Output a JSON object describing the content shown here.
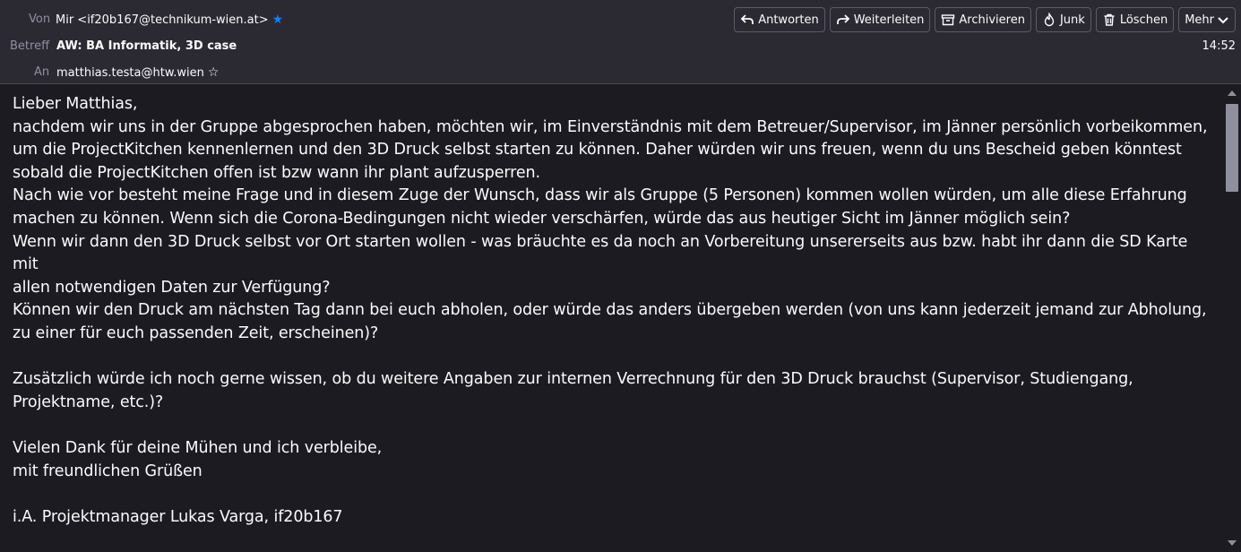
{
  "header": {
    "from_label": "Von",
    "from_value": "Mir <if20b167@technikum-wien.at>",
    "subject_label": "Betreff",
    "subject_value": "AW: BA Informatik, 3D case",
    "to_label": "An",
    "to_value": "matthias.testa@htw.wien",
    "time": "14:52"
  },
  "toolbar": {
    "reply": "Antworten",
    "forward": "Weiterleiten",
    "archive": "Archivieren",
    "junk": "Junk",
    "delete": "Löschen",
    "more": "Mehr"
  },
  "message": {
    "body": "Lieber Matthias,\nnachdem wir uns in der Gruppe abgesprochen haben, möchten wir, im Einverständnis mit dem Betreuer/Supervisor, im Jänner persönlich vorbeikommen,\num die ProjectKitchen kennenlernen und den 3D Druck selbst starten zu können. Daher würden wir uns freuen, wenn du uns Bescheid geben könntest\nsobald die ProjectKitchen offen ist bzw wann ihr plant aufzusperren.\nNach wie vor besteht meine Frage und in diesem Zuge der Wunsch, dass wir als Gruppe (5 Personen) kommen wollen würden, um alle diese Erfahrung\nmachen zu können. Wenn sich die Corona-Bedingungen nicht wieder verschärfen, würde das aus heutiger Sicht im Jänner möglich sein?\nWenn wir dann den 3D Druck selbst vor Ort starten wollen - was bräuchte es da noch an Vorbereitung unsererseits aus bzw. habt ihr dann die SD Karte mit\nallen notwendigen Daten zur Verfügung?\nKönnen wir den Druck am nächsten Tag dann bei euch abholen, oder würde das anders übergeben werden (von uns kann jederzeit jemand zur Abholung,\nzu einer für euch passenden Zeit, erscheinen)?\n\nZusätzlich würde ich noch gerne wissen, ob du weitere Angaben zur internen Verrechnung für den 3D Druck brauchst (Supervisor, Studiengang,\nProjektname, etc.)?\n\nVielen Dank für deine Mühen und ich verbleibe,\nmit freundlichen Grüßen\n\ni.A. Projektmanager Lukas Varga, if20b167"
  },
  "icons": {
    "reply": "reply-icon",
    "forward": "forward-icon",
    "archive": "archive-icon",
    "junk": "flame-icon",
    "delete": "trash-icon",
    "more": "chevron-down-icon",
    "star_filled": "star-filled-icon",
    "star_empty": "star-outline-icon"
  },
  "colors": {
    "background": "#1c1b22",
    "header": "#2b2a33",
    "accent_star": "#0a84ff",
    "label": "#8f8f9d"
  }
}
